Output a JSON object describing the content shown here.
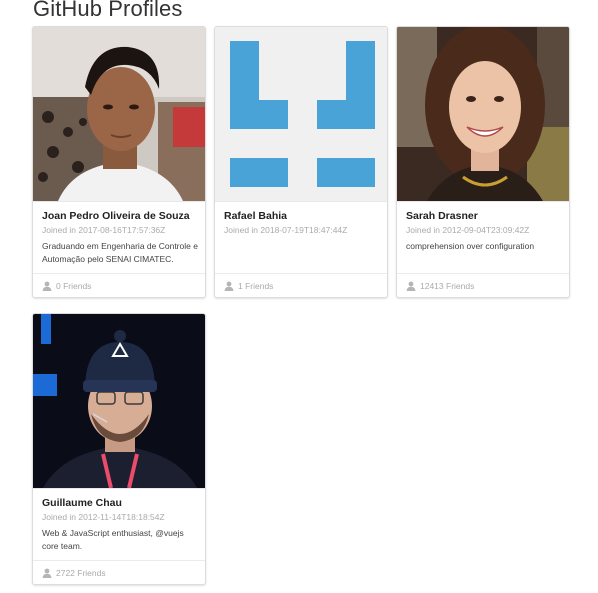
{
  "page": {
    "title": "GitHub Profiles"
  },
  "profiles": [
    {
      "name": "Joan Pedro Oliveira de Souza",
      "joined": "Joined in 2017-08-16T17:57:36Z",
      "bio": "Graduando em Engenharia de Controle e Automação pelo SENAI CIMATEC.",
      "friends": "0 Friends",
      "avatar": "photo-avatar"
    },
    {
      "name": "Rafael Bahia",
      "joined": "Joined in 2018-07-19T18:47:44Z",
      "bio": "",
      "friends": "1 Friends",
      "avatar": "identicon-avatar"
    },
    {
      "name": "Sarah Drasner",
      "joined": "Joined in 2012-09-04T23:09:42Z",
      "bio": "comprehension over configuration",
      "friends": "12413 Friends",
      "avatar": "photo-avatar"
    },
    {
      "name": "Guillaume Chau",
      "joined": "Joined in 2012-11-14T18:18:54Z",
      "bio": "Web & JavaScript enthusiast, @vuejs core team.",
      "friends": "2722 Friends",
      "avatar": "photo-avatar"
    }
  ],
  "colors": {
    "identicon": "#4aa3d6",
    "identicon_bg": "#f0f0f0",
    "muted_text": "#aaaaaa"
  }
}
